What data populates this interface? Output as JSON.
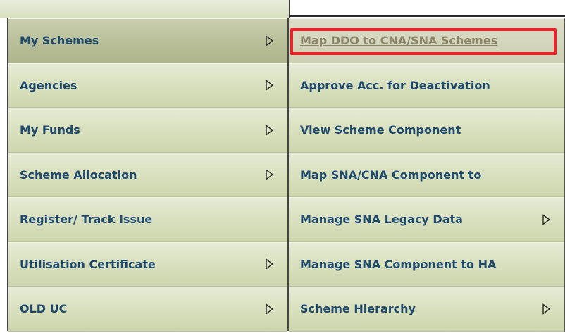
{
  "primary_menu": {
    "items": [
      {
        "label": "My Schemes",
        "has_submenu": true,
        "active": true
      },
      {
        "label": "Agencies",
        "has_submenu": true
      },
      {
        "label": "My Funds",
        "has_submenu": true
      },
      {
        "label": "Scheme Allocation",
        "has_submenu": true
      },
      {
        "label": "Register/ Track Issue",
        "has_submenu": false
      },
      {
        "label": "Utilisation Certificate",
        "has_submenu": true
      },
      {
        "label": "OLD UC",
        "has_submenu": true
      }
    ]
  },
  "secondary_menu": {
    "items": [
      {
        "label": "Map DDO to CNA/SNA Schemes",
        "has_submenu": false,
        "highlighted": true
      },
      {
        "label": "Approve Acc. for Deactivation",
        "has_submenu": false
      },
      {
        "label": "View Scheme Component",
        "has_submenu": false
      },
      {
        "label": "Map SNA/CNA Component to",
        "has_submenu": false
      },
      {
        "label": "Manage SNA Legacy Data",
        "has_submenu": true
      },
      {
        "label": "Manage SNA Component to HA",
        "has_submenu": false
      },
      {
        "label": "Scheme Hierarchy",
        "has_submenu": true
      }
    ]
  },
  "colors": {
    "menu_text": "#1f4a6e",
    "highlight_border": "#e8232a",
    "menu_bg": "#d7dfbc"
  },
  "icons": {
    "submenu_arrow": "triangle-right-outline-icon"
  }
}
